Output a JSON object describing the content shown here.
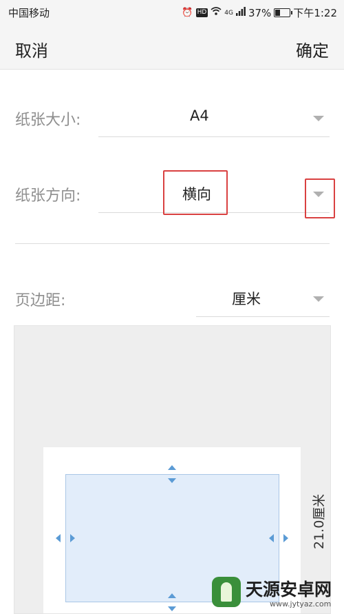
{
  "status_bar": {
    "carrier": "中国移动",
    "network": "4G",
    "battery": "37%",
    "battery_level": 0.37,
    "time": "下午1:22",
    "icons": [
      "alarm-icon",
      "hd-icon",
      "wifi-icon",
      "signal-icon",
      "battery-icon"
    ]
  },
  "header": {
    "cancel_label": "取消",
    "confirm_label": "确定"
  },
  "paper_settings": {
    "size_label": "纸张大小:",
    "size_value": "A4",
    "orientation_label": "纸张方向:",
    "orientation_value": "横向",
    "margin_label": "页边距:",
    "margin_unit": "厘米"
  },
  "preview": {
    "dimension_label": "21.0厘米"
  },
  "highlight_color": "#d94040",
  "accent_color": "#5b9bd5",
  "watermark": {
    "title": "天源安卓网",
    "url": "www.jytyaz.com"
  }
}
